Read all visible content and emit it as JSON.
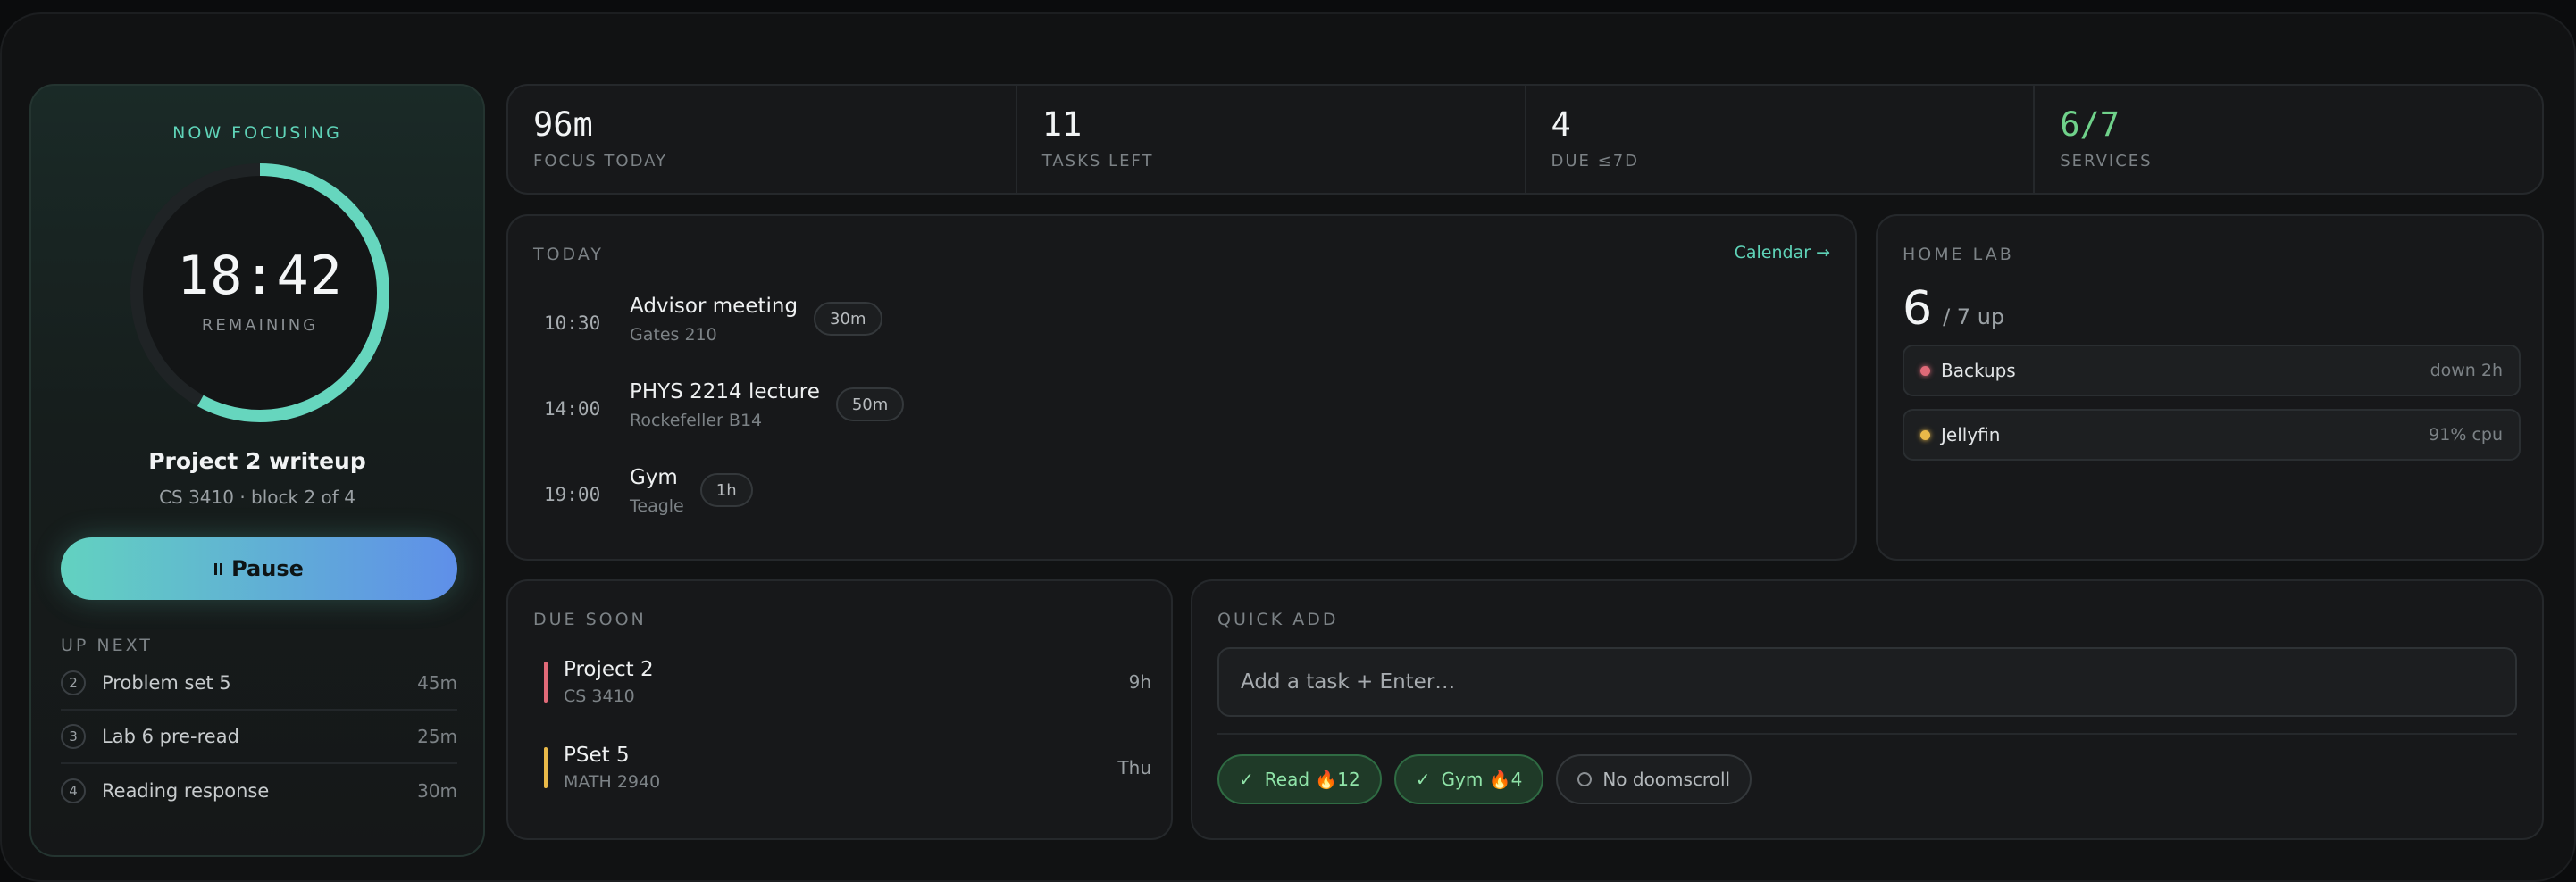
{
  "focus": {
    "eyebrow": "NOW FOCUSING",
    "time": "18:42",
    "time_sub": "REMAINING",
    "progress": 0.58,
    "task": "Project 2 writeup",
    "meta": "CS 3410 · block 2 of 4",
    "pause_label": "Pause",
    "up_next_label": "UP NEXT",
    "up_next": [
      {
        "n": "2",
        "name": "Problem set 5",
        "dur": "45m"
      },
      {
        "n": "3",
        "name": "Lab 6 pre-read",
        "dur": "25m"
      },
      {
        "n": "4",
        "name": "Reading response",
        "dur": "30m"
      }
    ]
  },
  "stats": [
    {
      "value": "96m",
      "label": "FOCUS TODAY"
    },
    {
      "value": "11",
      "label": "TASKS LEFT"
    },
    {
      "value": "4",
      "label": "DUE ≤7D"
    },
    {
      "value": "6/7",
      "label": "SERVICES"
    }
  ],
  "today": {
    "label": "TODAY",
    "calendar_link": "Calendar →",
    "events": [
      {
        "time": "10:30",
        "title": "Advisor meeting",
        "loc": "Gates 210",
        "dur": "30m"
      },
      {
        "time": "14:00",
        "title": "PHYS 2214 lecture",
        "loc": "Rockefeller B14",
        "dur": "50m"
      },
      {
        "time": "19:00",
        "title": "Gym",
        "loc": "Teagle",
        "dur": "1h"
      }
    ]
  },
  "homelab": {
    "label": "HOME LAB",
    "up": "6",
    "total": "/ 7 up",
    "services": [
      {
        "name": "Backups",
        "status": "down 2h",
        "color": "#e06a78"
      },
      {
        "name": "Jellyfin",
        "status": "91% cpu",
        "color": "#e9b949"
      }
    ]
  },
  "due": {
    "label": "DUE SOON",
    "items": [
      {
        "title": "Project 2",
        "course": "CS 3410",
        "when": "9h",
        "color": "#e06a78"
      },
      {
        "title": "PSet 5",
        "course": "MATH 2940",
        "when": "Thu",
        "color": "#e9b949"
      }
    ]
  },
  "quick": {
    "label": "QUICK ADD",
    "placeholder": "Add a task + Enter…",
    "habits": [
      {
        "label": "Read 🔥12",
        "done": true
      },
      {
        "label": "Gym 🔥4",
        "done": true
      },
      {
        "label": "No doomscroll",
        "done": false
      }
    ]
  },
  "colors": {
    "accent": "#5fd3b8",
    "green": "#6fd18a",
    "red": "#e06a78",
    "amber": "#e9b949"
  }
}
